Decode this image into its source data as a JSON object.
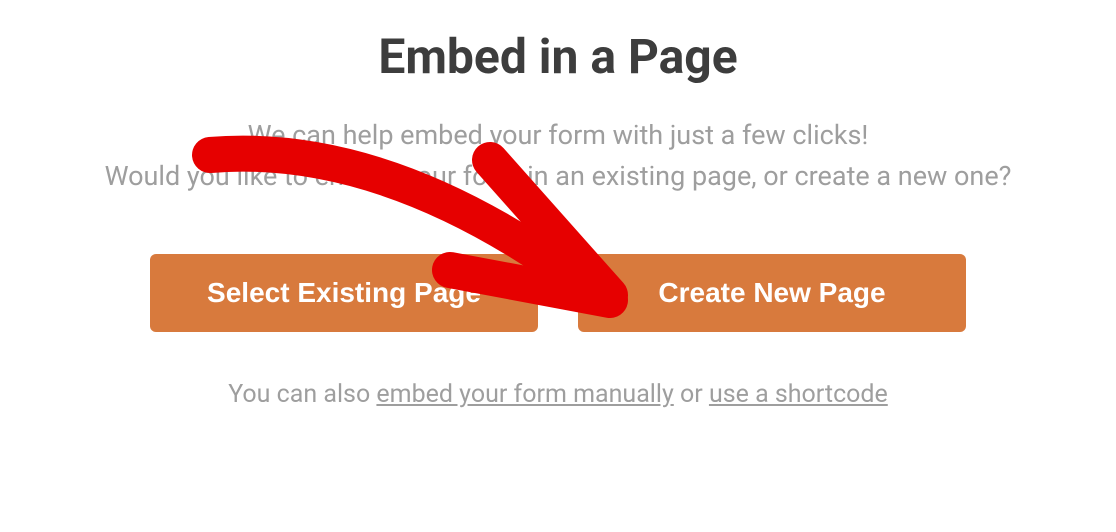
{
  "title": "Embed in a Page",
  "description": {
    "line1": "We can help embed your form with just a few clicks!",
    "line2": "Would you like to embed your form in an existing page, or create a new one?"
  },
  "buttons": {
    "select_existing": "Select Existing Page",
    "create_new": "Create New Page"
  },
  "footer": {
    "prefix": "You can also ",
    "link1": "embed your form manually",
    "middle": " or ",
    "link2": "use a shortcode"
  },
  "annotation": {
    "type": "arrow",
    "color": "#e60000",
    "points_to": "create-new-page-button"
  }
}
